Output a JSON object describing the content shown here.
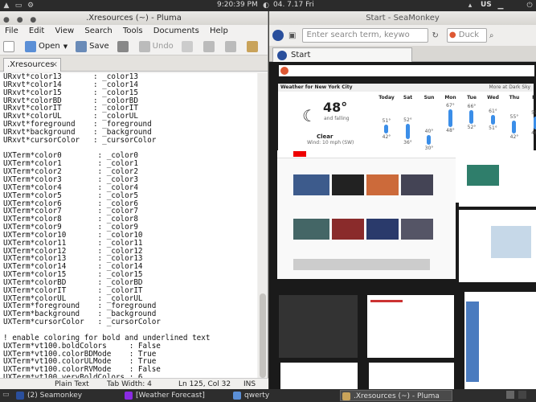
{
  "topbar": {
    "clock": "9:20:39 PM",
    "date": "04. 7.17 Fri",
    "lang": "US"
  },
  "pluma": {
    "title": ".Xresources (~) - Pluma",
    "menu": [
      "File",
      "Edit",
      "View",
      "Search",
      "Tools",
      "Documents",
      "Help"
    ],
    "toolbar": {
      "open": "Open",
      "save": "Save",
      "undo": "Undo"
    },
    "tab": ".Xresources",
    "lines": [
      "URxvt*color13       : _color13",
      "URxvt*color14       : _color14",
      "URxvt*color15       : _color15",
      "URxvt*colorBD       : _colorBD",
      "URxvt*colorIT       : _colorIT",
      "URxvt*colorUL       : _colorUL",
      "URxvt*foreground    : _foreground",
      "URxvt*background    : _background",
      "URxvt*cursorColor   : _cursorColor",
      "",
      "UXTerm*color0        : _color0",
      "UXTerm*color1        : _color1",
      "UXTerm*color2        : _color2",
      "UXTerm*color3        : _color3",
      "UXTerm*color4        : _color4",
      "UXTerm*color5        : _color5",
      "UXTerm*color6        : _color6",
      "UXTerm*color7        : _color7",
      "UXTerm*color8        : _color8",
      "UXTerm*color9        : _color9",
      "UXTerm*color10       : _color10",
      "UXTerm*color11       : _color11",
      "UXTerm*color12       : _color12",
      "UXTerm*color13       : _color13",
      "UXTerm*color14       : _color14",
      "UXTerm*color15       : _color15",
      "UXTerm*colorBD       : _colorBD",
      "UXTerm*colorIT       : _colorIT",
      "UXTerm*colorUL       : _colorUL",
      "UXTerm*foreground    : _foreground",
      "UXTerm*background    : _background",
      "UXTerm*cursorColor   : _cursorColor",
      "",
      "! enable coloring for bold and underlined text",
      "UXTerm*vt100.boldColors     : False",
      "UXTerm*vt100.colorBDMode    : True",
      "UXTerm*vt100.colorULMode    : True",
      "UXTerm*vt100.colorRVMode    : False",
      "UXTerm*vt100.veryBoldColors : 6"
    ],
    "status": {
      "lang": "Plain Text",
      "tab": "Tab Width: 4",
      "pos": "Ln 125, Col 32",
      "mode": "INS"
    }
  },
  "seamonkey": {
    "title": "Start - SeaMonkey",
    "url_placeholder": "Enter search term, keywo",
    "search_placeholder": "Duck",
    "tab": "Start",
    "weather": {
      "title": "Weather for New York City",
      "more": "More at Dark Sky",
      "temp": "48°",
      "trend": "and falling",
      "cond": "Clear",
      "wind": "Wind: 10 mph (SW)",
      "days": [
        {
          "d": "Today",
          "hi": "51°",
          "lo": "42°"
        },
        {
          "d": "Sat",
          "hi": "52°",
          "lo": "36°"
        },
        {
          "d": "Sun",
          "hi": "40°",
          "lo": "30°"
        },
        {
          "d": "Mon",
          "hi": "67°",
          "lo": "48°"
        },
        {
          "d": "Tue",
          "hi": "66°",
          "lo": "52°"
        },
        {
          "d": "Wed",
          "hi": "61°",
          "lo": "51°"
        },
        {
          "d": "Thu",
          "hi": "55°",
          "lo": "42°"
        },
        {
          "d": "Fri",
          "hi": "59°",
          "lo": "46°"
        }
      ]
    }
  },
  "taskbar": {
    "items": [
      "(2) Seamonkey",
      "[Weather Forecast]",
      "qwerty",
      ".Xresources (~) - Pluma"
    ]
  }
}
